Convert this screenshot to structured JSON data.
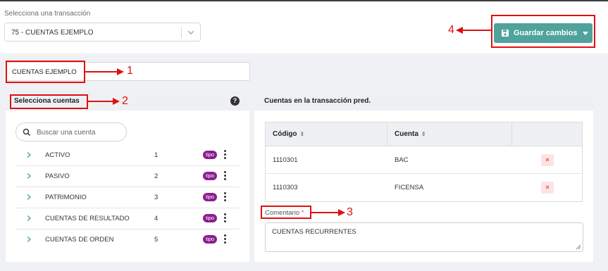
{
  "header": {
    "select_label": "Selecciona una transacción",
    "select_value": "75 - CUENTAS EJEMPLO",
    "save_button_label": "Guardar cambios"
  },
  "name_input": {
    "value": "CUENTAS EJEMPLO"
  },
  "left_panel": {
    "title": "Selecciona cuentas",
    "help_glyph": "?",
    "search_placeholder": "Buscar una cuenta",
    "accounts": [
      {
        "name": "ACTIVO",
        "number": "1",
        "badge": "tipo"
      },
      {
        "name": "PASIVO",
        "number": "2",
        "badge": "tipo"
      },
      {
        "name": "PATRIMONIO",
        "number": "3",
        "badge": "tipo"
      },
      {
        "name": "CUENTAS DE RESULTADO",
        "number": "4",
        "badge": "tipo"
      },
      {
        "name": "CUENTAS DE ORDEN",
        "number": "5",
        "badge": "tipo"
      }
    ]
  },
  "right_panel": {
    "title": "Cuentas en la transacción pred.",
    "table": {
      "headers": [
        "Código",
        "Cuenta"
      ],
      "rows": [
        {
          "code": "1110301",
          "account": "BAC",
          "delete": "×"
        },
        {
          "code": "1110303",
          "account": "FICENSA",
          "delete": "×"
        }
      ]
    },
    "comment_label": "Comentario",
    "comment_required_mark": "*",
    "comment_value": "CUENTAS RECURRENTES"
  },
  "annotations": [
    "1",
    "2",
    "3",
    "4"
  ],
  "colors": {
    "accent": "#4fa39c",
    "badge": "#8a1d8f",
    "annotation": "#e01010",
    "delete": "#e04848"
  }
}
